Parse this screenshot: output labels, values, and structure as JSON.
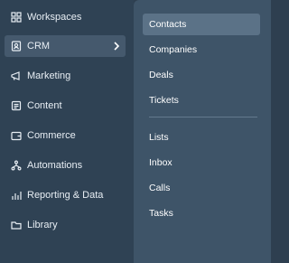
{
  "sidebar": {
    "items": [
      {
        "label": "Workspaces",
        "icon": "grid-icon"
      },
      {
        "label": "CRM",
        "icon": "contact-card-icon",
        "active": true
      },
      {
        "label": "Marketing",
        "icon": "megaphone-icon"
      },
      {
        "label": "Content",
        "icon": "document-icon"
      },
      {
        "label": "Commerce",
        "icon": "wallet-icon"
      },
      {
        "label": "Automations",
        "icon": "workflow-icon"
      },
      {
        "label": "Reporting & Data",
        "icon": "bar-chart-icon"
      },
      {
        "label": "Library",
        "icon": "folder-icon"
      }
    ]
  },
  "submenu": {
    "group1": [
      "Contacts",
      "Companies",
      "Deals",
      "Tickets"
    ],
    "group2": [
      "Lists",
      "Inbox",
      "Calls",
      "Tasks"
    ]
  },
  "colors": {
    "sidebar_bg": "#2f4254",
    "submenu_bg": "#3e5468",
    "active_sub_bg": "#5b7287",
    "text": "#ffffff"
  }
}
